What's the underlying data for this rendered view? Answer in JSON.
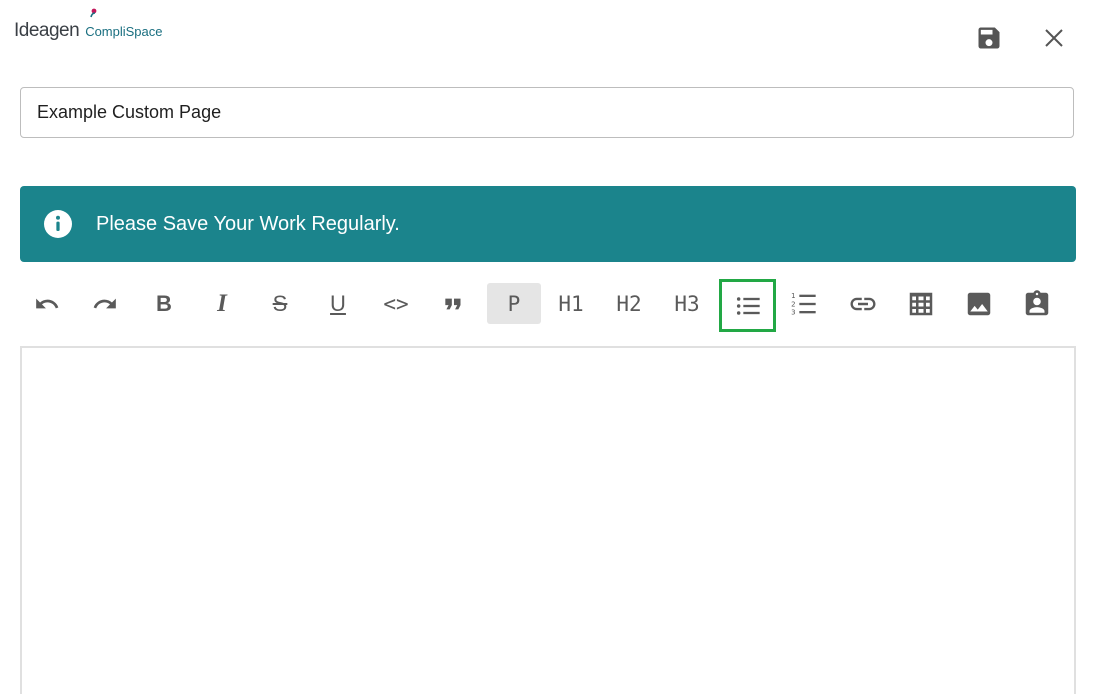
{
  "header": {
    "logo_main": "Ideagen",
    "logo_sub": "CompliSpace",
    "save_icon": "save-icon",
    "close_icon": "close-icon"
  },
  "title_input": {
    "value": "Example Custom Page"
  },
  "banner": {
    "icon": "info-icon",
    "text": "Please Save Your Work Regularly.",
    "color": "#1b848c"
  },
  "toolbar": {
    "undo_icon": "undo-icon",
    "redo_icon": "redo-icon",
    "bold_label": "B",
    "italic_label": "I",
    "strike_label": "S",
    "underline_label": "U",
    "code_label": "<>",
    "quote_icon": "quote-icon",
    "paragraph_label": "P",
    "h1_label": "H1",
    "h2_label": "H2",
    "h3_label": "H3",
    "bullet_list_icon": "bullet-list-icon",
    "numbered_list_icon": "numbered-list-icon",
    "link_icon": "link-icon",
    "table_icon": "table-icon",
    "image_icon": "image-icon",
    "template_icon": "clipboard-user-icon",
    "highlight_color": "#22a845"
  },
  "editor": {
    "content": ""
  }
}
